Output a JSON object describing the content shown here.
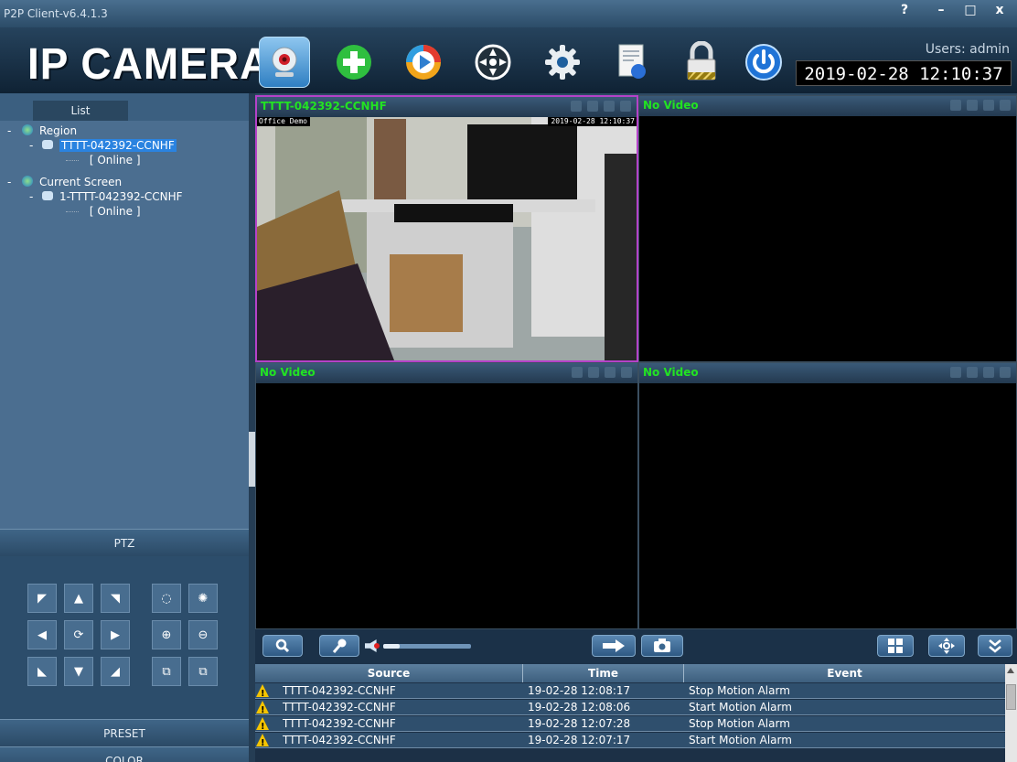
{
  "window": {
    "title": "P2P Client-v6.4.1.3",
    "help": "?",
    "minimize": "–",
    "maximize": "□",
    "close": "x"
  },
  "header": {
    "logo": "IP CAMERA",
    "users": "Users: admin",
    "datetime": "2019-02-28 12:10:37",
    "toolbar": [
      "camera-icon",
      "add-icon",
      "playback-icon",
      "ptz-control-icon",
      "settings-icon",
      "log-icon",
      "lock-icon",
      "power-icon"
    ]
  },
  "sidebar": {
    "tab": "List",
    "tree": [
      {
        "prefix": "-",
        "label": "Region"
      },
      {
        "prefix": "-",
        "label": "TTTT-042392-CCNHF"
      },
      {
        "label": "[  Online  ]"
      },
      {
        "prefix": "-",
        "label": "Current Screen"
      },
      {
        "prefix": "-",
        "label": "1-TTTT-042392-CCNHF"
      },
      {
        "label": "[  Online  ]"
      }
    ],
    "ptz_label": "PTZ",
    "preset_label": "PRESET",
    "color_label": "COLOR"
  },
  "video": {
    "panes": [
      {
        "title": "TTTT-042392-CCNHF",
        "overlay_left": "Office Demo",
        "overlay_right": "2019-02-28 12:10:37"
      },
      {
        "title": "No Video"
      },
      {
        "title": "No Video"
      },
      {
        "title": "No Video"
      }
    ]
  },
  "events": {
    "headers": {
      "source": "Source",
      "time": "Time",
      "event": "Event"
    },
    "rows": [
      {
        "source": "TTTT-042392-CCNHF",
        "time": "19-02-28 12:08:17",
        "event": "Stop Motion Alarm"
      },
      {
        "source": "TTTT-042392-CCNHF",
        "time": "19-02-28 12:08:06",
        "event": "Start Motion Alarm"
      },
      {
        "source": "TTTT-042392-CCNHF",
        "time": "19-02-28 12:07:28",
        "event": "Stop Motion Alarm"
      },
      {
        "source": "TTTT-042392-CCNHF",
        "time": "19-02-28 12:07:17",
        "event": "Start Motion Alarm"
      }
    ]
  },
  "colors": {
    "accent": "#22e322",
    "selected_pane": "#b442c9",
    "selection": "#2a83e0",
    "warning": "#f5c400"
  }
}
